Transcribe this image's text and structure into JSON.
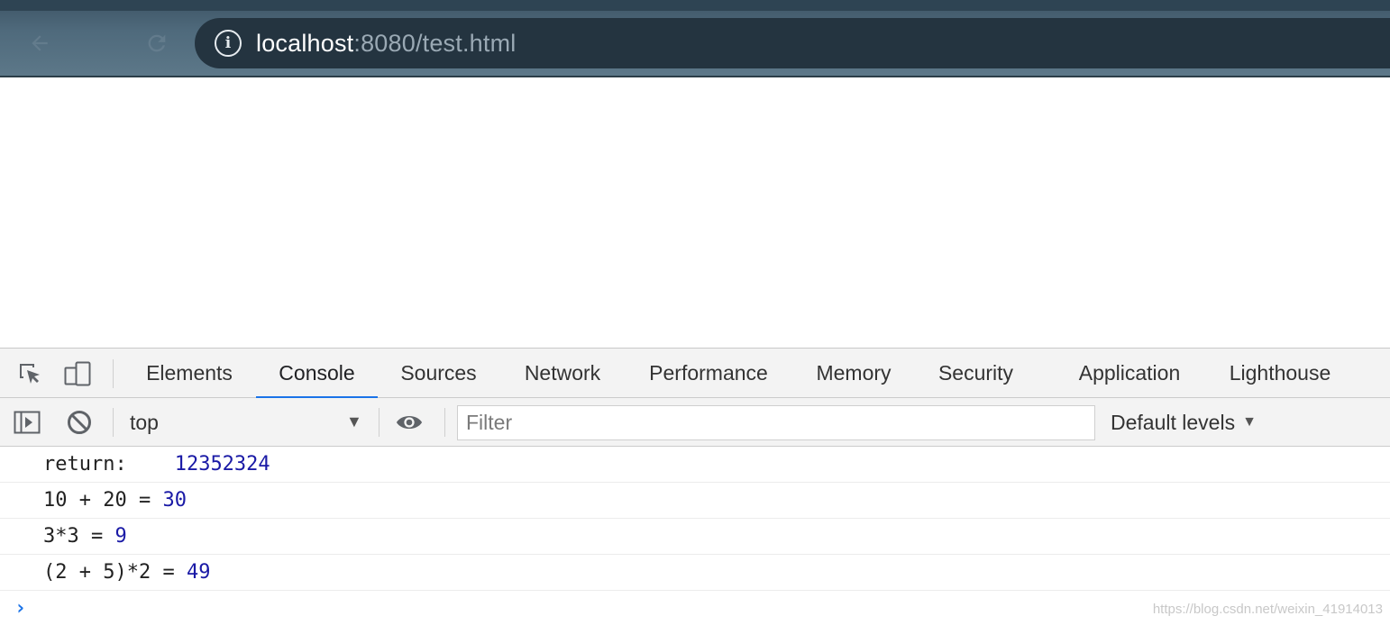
{
  "browser": {
    "url_host": "localhost",
    "url_rest": ":8080/test.html",
    "info_glyph": "i"
  },
  "devtools": {
    "tabs": [
      {
        "label": "Elements"
      },
      {
        "label": "Console",
        "active": true
      },
      {
        "label": "Sources"
      },
      {
        "label": "Network"
      },
      {
        "label": "Performance"
      },
      {
        "label": "Memory"
      },
      {
        "label": "Security"
      },
      {
        "label": "Application"
      },
      {
        "label": "Lighthouse"
      }
    ],
    "accent_color": "#1a73e8",
    "toolbar": {
      "context": "top",
      "filter_placeholder": "Filter",
      "levels_label": "Default levels"
    },
    "console": {
      "rows": [
        {
          "text": "return:    ",
          "value": "12352324"
        },
        {
          "text": "10 + 20 = ",
          "value": "30"
        },
        {
          "text": "3*3 = ",
          "value": "9"
        },
        {
          "text": "(2 + 5)*2 = ",
          "value": "49"
        }
      ],
      "value_color": "#1a1aa6"
    },
    "watermark": "https://blog.csdn.net/weixin_41914013"
  }
}
